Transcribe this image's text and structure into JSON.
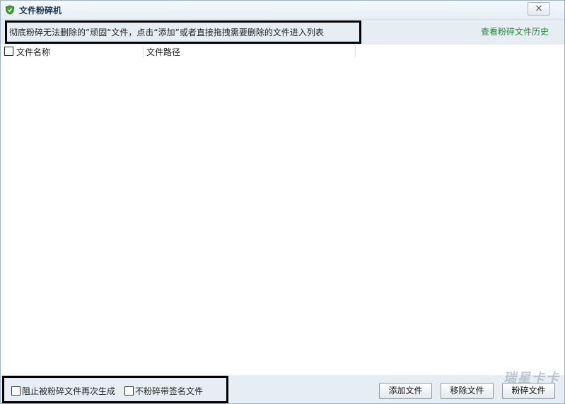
{
  "window": {
    "title": "文件粉碎机",
    "close_symbol": "×"
  },
  "hint": {
    "text": "彻底粉碎无法删除的”顽固“文件，点击“添加”或者直接拖拽需要删除的文件进入列表",
    "history_link": "查看粉碎文件历史"
  },
  "list": {
    "columns": [
      "文件名称",
      "文件路径"
    ],
    "rows": []
  },
  "footer": {
    "options": [
      {
        "label": "阻止被粉碎文件再次生成",
        "checked": false
      },
      {
        "label": "不粉碎带签名文件",
        "checked": false
      }
    ],
    "buttons": {
      "add": "添加文件",
      "remove": "移除文件",
      "shred": "粉碎文件"
    }
  },
  "watermark": "瑞星卡卡",
  "colors": {
    "accent_green": "#1c8c2a",
    "panel_bg": "#e6eef3"
  }
}
